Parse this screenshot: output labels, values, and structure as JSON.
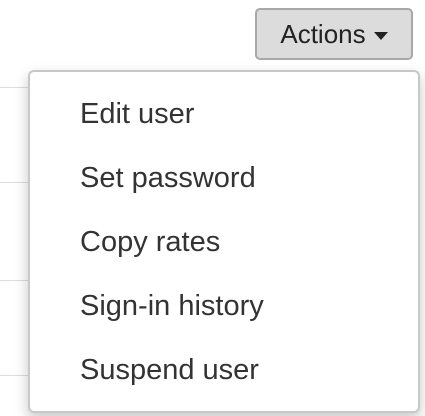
{
  "actions_button": {
    "label": "Actions",
    "icon": "caret-down-icon"
  },
  "menu": {
    "items": [
      {
        "label": "Edit user"
      },
      {
        "label": "Set password"
      },
      {
        "label": "Copy rates"
      },
      {
        "label": "Sign-in history"
      },
      {
        "label": "Suspend user"
      }
    ]
  },
  "colors": {
    "button_bg": "#dcdcdc",
    "button_border": "#a8a8a8",
    "menu_border": "#c8c8c8",
    "text": "#333333"
  }
}
